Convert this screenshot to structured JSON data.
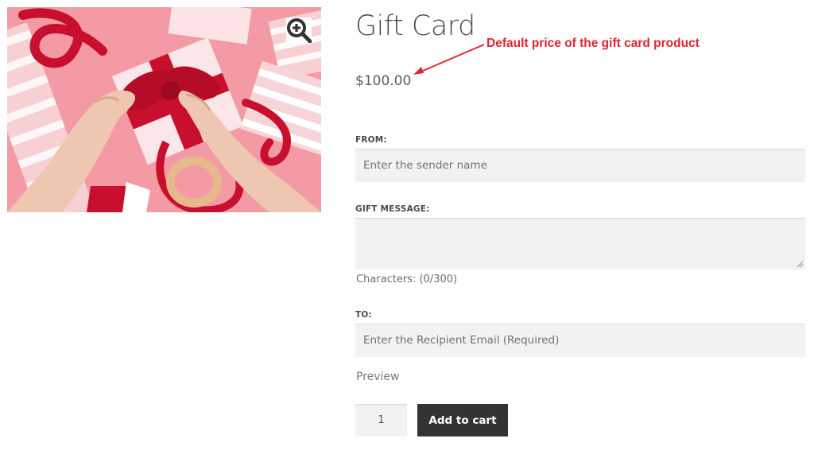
{
  "product": {
    "title": "Gift Card",
    "price": "$100.00",
    "image_icon": "gift-wrapping-photo"
  },
  "annotation": {
    "text": "Default price of the gift card product",
    "color": "#e0242f"
  },
  "gallery": {
    "zoom_icon": "magnifier-plus-icon"
  },
  "form": {
    "from": {
      "label": "FROM:",
      "placeholder": "Enter the sender name",
      "value": ""
    },
    "message": {
      "label": "GIFT MESSAGE:",
      "value": "",
      "char_count": "Characters: (0/300)"
    },
    "to": {
      "label": "TO:",
      "placeholder": "Enter the Recipient Email (Required)",
      "value": ""
    },
    "preview_label": "Preview",
    "quantity": "1",
    "add_to_cart_label": "Add to cart"
  },
  "colors": {
    "button_bg": "#333333",
    "input_bg": "#f2f2f2"
  }
}
